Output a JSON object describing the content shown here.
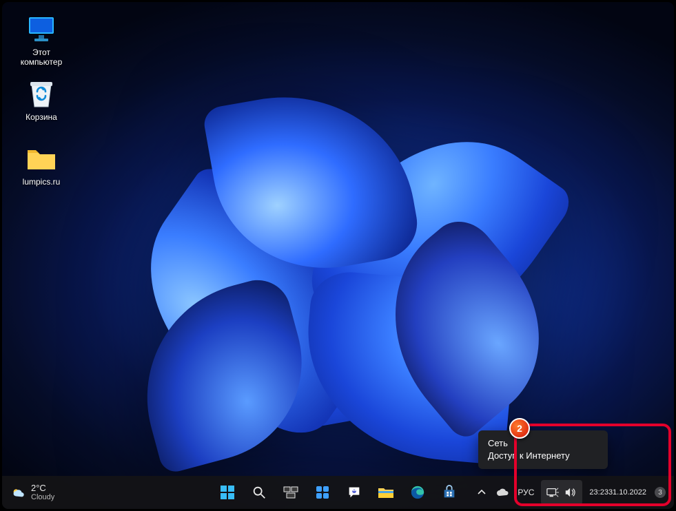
{
  "desktop_icons": {
    "this_pc": "Этот\nкомпьютер",
    "recycle_bin": "Корзина",
    "folder": "lumpics.ru"
  },
  "weather": {
    "temp": "2°C",
    "cond": "Cloudy"
  },
  "tray": {
    "lang": "РУС",
    "time": "23:23",
    "date": "31.10.2022",
    "notif_count": "3"
  },
  "tooltip": {
    "title": "Сеть",
    "status": "Доступ к Интернету"
  },
  "annotation": {
    "badge": "2"
  }
}
